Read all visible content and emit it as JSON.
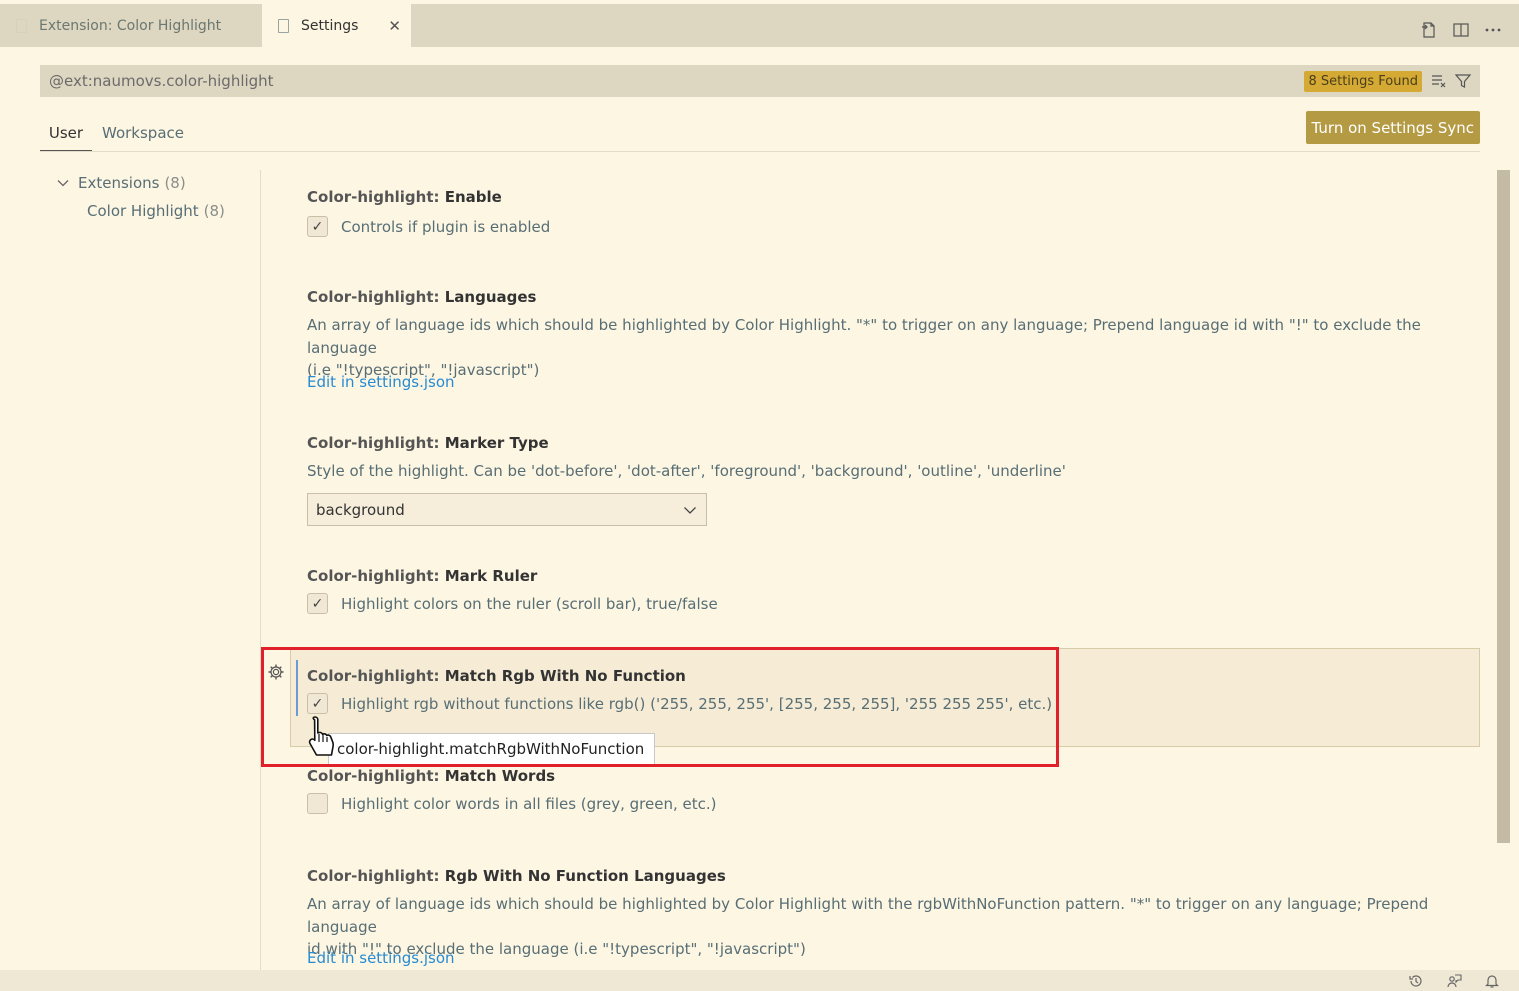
{
  "tabs": [
    {
      "label": "Extension: Color Highlight"
    },
    {
      "label": "Settings",
      "close": "✕"
    }
  ],
  "top_actions": {
    "icons": [
      "open-settings-json-icon",
      "split-editor-icon",
      "more-actions-icon"
    ]
  },
  "search": {
    "value": "@ext:naumovs.color-highlight",
    "found": "8 Settings Found"
  },
  "scopes": {
    "user": "User",
    "workspace": "Workspace"
  },
  "sync_button": "Turn on Settings Sync",
  "toc": {
    "extensions": {
      "label": "Extensions",
      "count": "(8)"
    },
    "color_highlight": {
      "label": "Color Highlight",
      "count": "(8)"
    }
  },
  "settings": [
    {
      "category": "Color-highlight: ",
      "name": "Enable",
      "checkbox_label": "Controls if plugin is enabled",
      "checked": true
    },
    {
      "category": "Color-highlight: ",
      "name": "Languages",
      "desc1": "An array of language ids which should be highlighted by Color Highlight. \"*\" to trigger on any language; Prepend language id with \"!\" to exclude the language",
      "desc2": "(i.e \"!typescript\", \"!javascript\")",
      "link": "Edit in settings.json"
    },
    {
      "category": "Color-highlight: ",
      "name": "Marker Type",
      "desc": "Style of the highlight. Can be 'dot-before', 'dot-after', 'foreground', 'background', 'outline', 'underline'",
      "select_value": "background"
    },
    {
      "category": "Color-highlight: ",
      "name": "Mark Ruler",
      "checkbox_label": "Highlight colors on the ruler (scroll bar), true/false",
      "checked": true
    },
    {
      "category": "Color-highlight: ",
      "name": "Match Rgb With No Function",
      "checkbox_label": "Highlight rgb without functions like rgb() ('255, 255, 255', [255, 255, 255], '255 255 255', etc.)",
      "checked": true
    },
    {
      "category": "Color-highlight: ",
      "name": "Match Words",
      "checkbox_label": "Highlight color words in all files (grey, green, etc.)",
      "checked": false
    },
    {
      "category": "Color-highlight: ",
      "name": "Rgb With No Function Languages",
      "desc1": "An array of language ids which should be highlighted by Color Highlight with the rgbWithNoFunction pattern. \"*\" to trigger on any language; Prepend language",
      "desc2": "id with \"!\" to exclude the language (i.e \"!typescript\", \"!javascript\")",
      "link": "Edit in settings.json"
    }
  ],
  "tooltip": "color-highlight.matchRgbWithNoFunction",
  "checkmark": "✓",
  "colors": {
    "background": "#fdf6e3",
    "accent_button": "#b49a43",
    "badge": "#d4aa35",
    "link": "#268bd2",
    "highlight_box": "#e0202a"
  }
}
